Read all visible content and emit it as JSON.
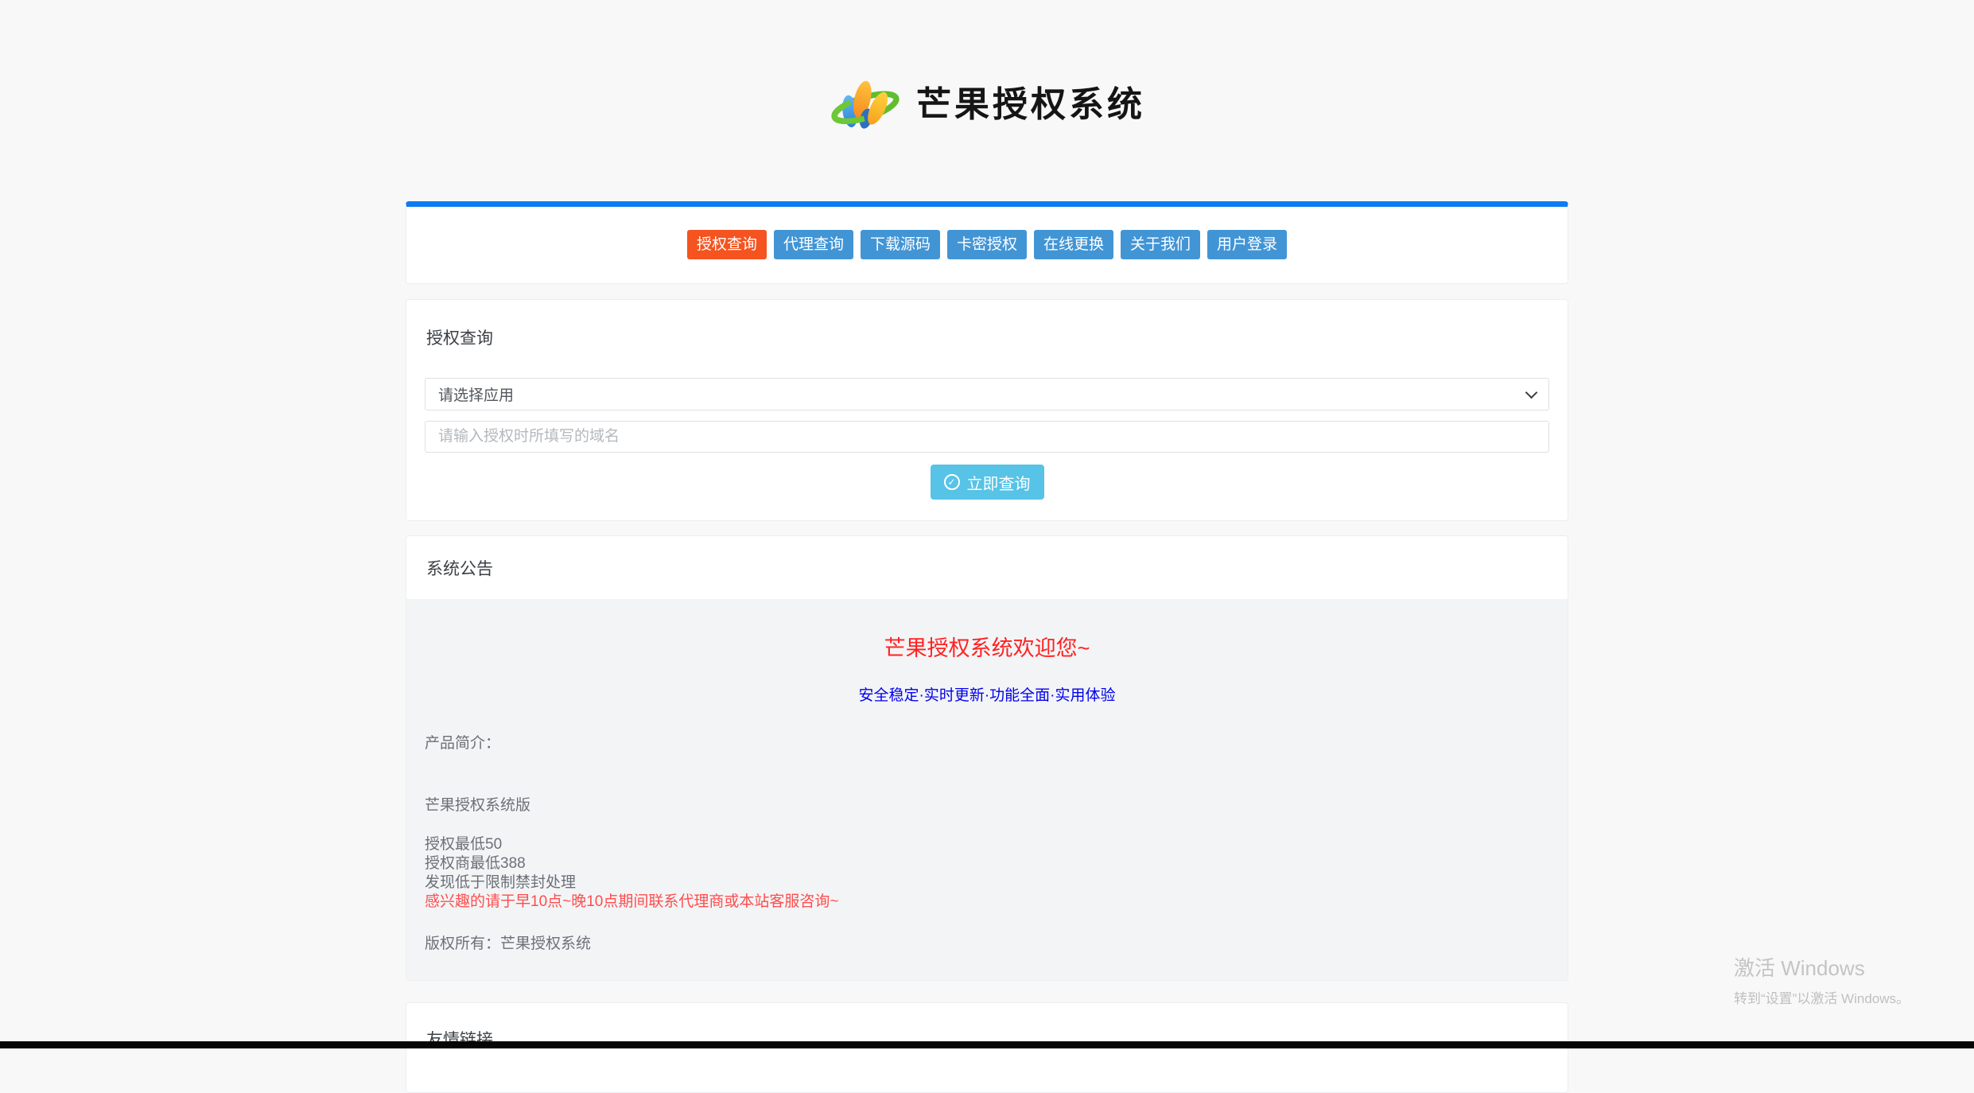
{
  "theme": {
    "accent_blue": "#0d7bf2",
    "nav_blue": "#4295d5",
    "nav_active_orange": "#f5531f",
    "submit_cyan": "#57c3e6",
    "headline_red": "#ff2222",
    "subheadline_blue": "#0000ee",
    "highlight_red": "#ff4d4d",
    "page_bg": "#f8f8f8",
    "notice_bg": "#f3f4f6"
  },
  "header": {
    "logo_text": "芒果授权系统",
    "logo_icon": "mango-m-swoosh-logo"
  },
  "nav": {
    "items": [
      {
        "label": "授权查询",
        "active": true
      },
      {
        "label": "代理查询",
        "active": false
      },
      {
        "label": "下载源码",
        "active": false
      },
      {
        "label": "卡密授权",
        "active": false
      },
      {
        "label": "在线更换",
        "active": false
      },
      {
        "label": "关于我们",
        "active": false
      },
      {
        "label": "用户登录",
        "active": false
      }
    ]
  },
  "query_panel": {
    "title": "授权查询",
    "app_select": {
      "value": "请选择应用",
      "chevron_icon": "chevron-down-icon"
    },
    "domain_input": {
      "placeholder": "请输入授权时所填写的域名",
      "value": ""
    },
    "submit": {
      "label": "立即查询",
      "icon": "check-circle-icon",
      "check_glyph": "✓"
    }
  },
  "announcement_panel": {
    "title": "系统公告",
    "headline": "芒果授权系统欢迎您~",
    "subheadline": "安全稳定·实时更新·功能全面·实用体验",
    "intro_label": "产品简介：",
    "product_name": "芒果授权系统版",
    "lines": [
      "授权最低50",
      "授权商最低388",
      "发现低于限制禁封处理"
    ],
    "highlight_line": "感兴趣的请于早10点~晚10点期间联系代理商或本站客服咨询~",
    "copyright_line": "版权所有：芒果授权系统"
  },
  "links_panel": {
    "title": "友情链接"
  },
  "watermark": {
    "line1": "激活 Windows",
    "line2": "转到“设置”以激活 Windows。"
  }
}
